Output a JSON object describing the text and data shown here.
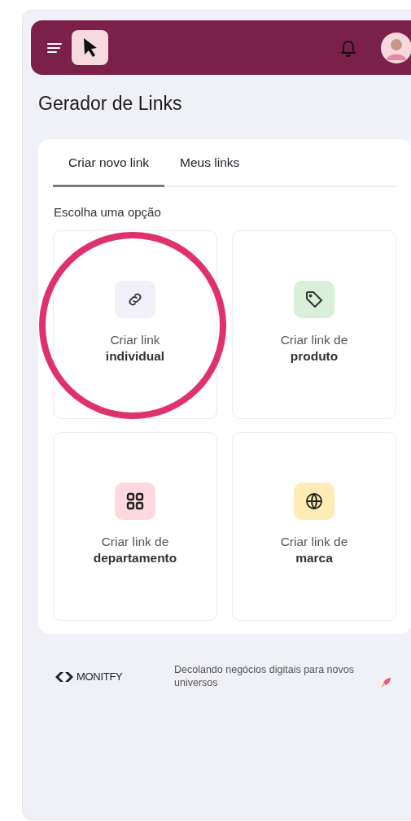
{
  "page_title": "Gerador de Links",
  "tabs": [
    {
      "label": "Criar novo link",
      "selected": true
    },
    {
      "label": "Meus links",
      "selected": false
    }
  ],
  "section_label": "Escolha uma opção",
  "options": [
    {
      "kind": "link",
      "color": "#eff0f8",
      "line1": "Criar link",
      "line2": "individual",
      "highlighted": true
    },
    {
      "kind": "tag",
      "color": "#d9efd9",
      "line1": "Criar link de",
      "line2": "produto",
      "highlighted": false
    },
    {
      "kind": "grid",
      "color": "#ffd9df",
      "line1": "Criar link de",
      "line2": "departamento",
      "highlighted": false
    },
    {
      "kind": "globe",
      "color": "#ffecb5",
      "line1": "Criar link de",
      "line2": "marca",
      "highlighted": false
    }
  ],
  "footer": {
    "brand": "MONITFY",
    "tagline": "Decolando negócios digitais para novos universos"
  }
}
